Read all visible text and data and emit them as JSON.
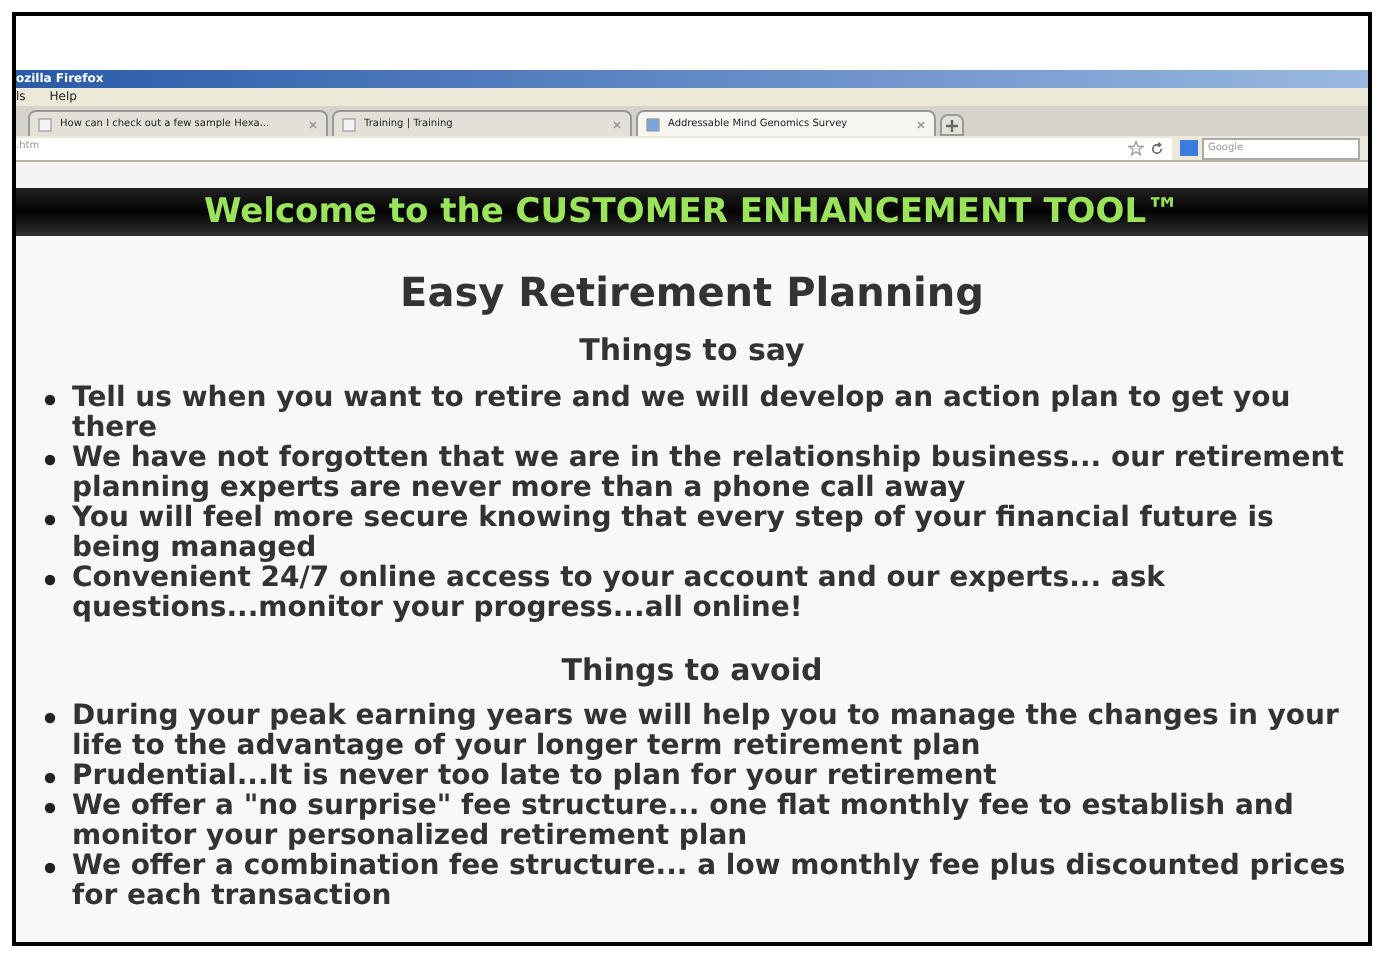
{
  "window": {
    "title": "ozilla Firefox"
  },
  "menu": [
    "ls",
    "Help"
  ],
  "tabs": [
    {
      "label": "How can I check out a few sample Hexa...",
      "selected": false
    },
    {
      "label": "Training | Training",
      "selected": false
    },
    {
      "label": "Addressable Mind Genomics Survey",
      "selected": true
    }
  ],
  "address_bar": {
    "value": ".htm"
  },
  "search": {
    "placeholder": "Google"
  },
  "banner": "Welcome to the CUSTOMER ENHANCEMENT TOOL™",
  "heading": "Easy Retirement Planning",
  "sections": [
    {
      "title": "Things to say",
      "items": [
        "Tell us when you want to retire and we will develop an action plan to get you there",
        "We have not forgotten that we are in the relationship business... our retirement planning experts are never more than a phone call away",
        "You will feel more secure knowing that every step of your financial future is being managed",
        "Convenient 24/7 online access to your account and our experts... ask questions...monitor your progress...all online!"
      ]
    },
    {
      "title": "Things to avoid",
      "items": [
        "During your peak earning years we will help you to manage the changes in your life to the advantage of your longer term retirement plan",
        "Prudential...It is never too late to plan for your retirement",
        "We offer a \"no surprise\" fee structure... one flat monthly fee to establish and monitor your personalized retirement plan",
        "We offer a combination fee structure... a low monthly fee plus discounted prices for each transaction"
      ]
    }
  ]
}
